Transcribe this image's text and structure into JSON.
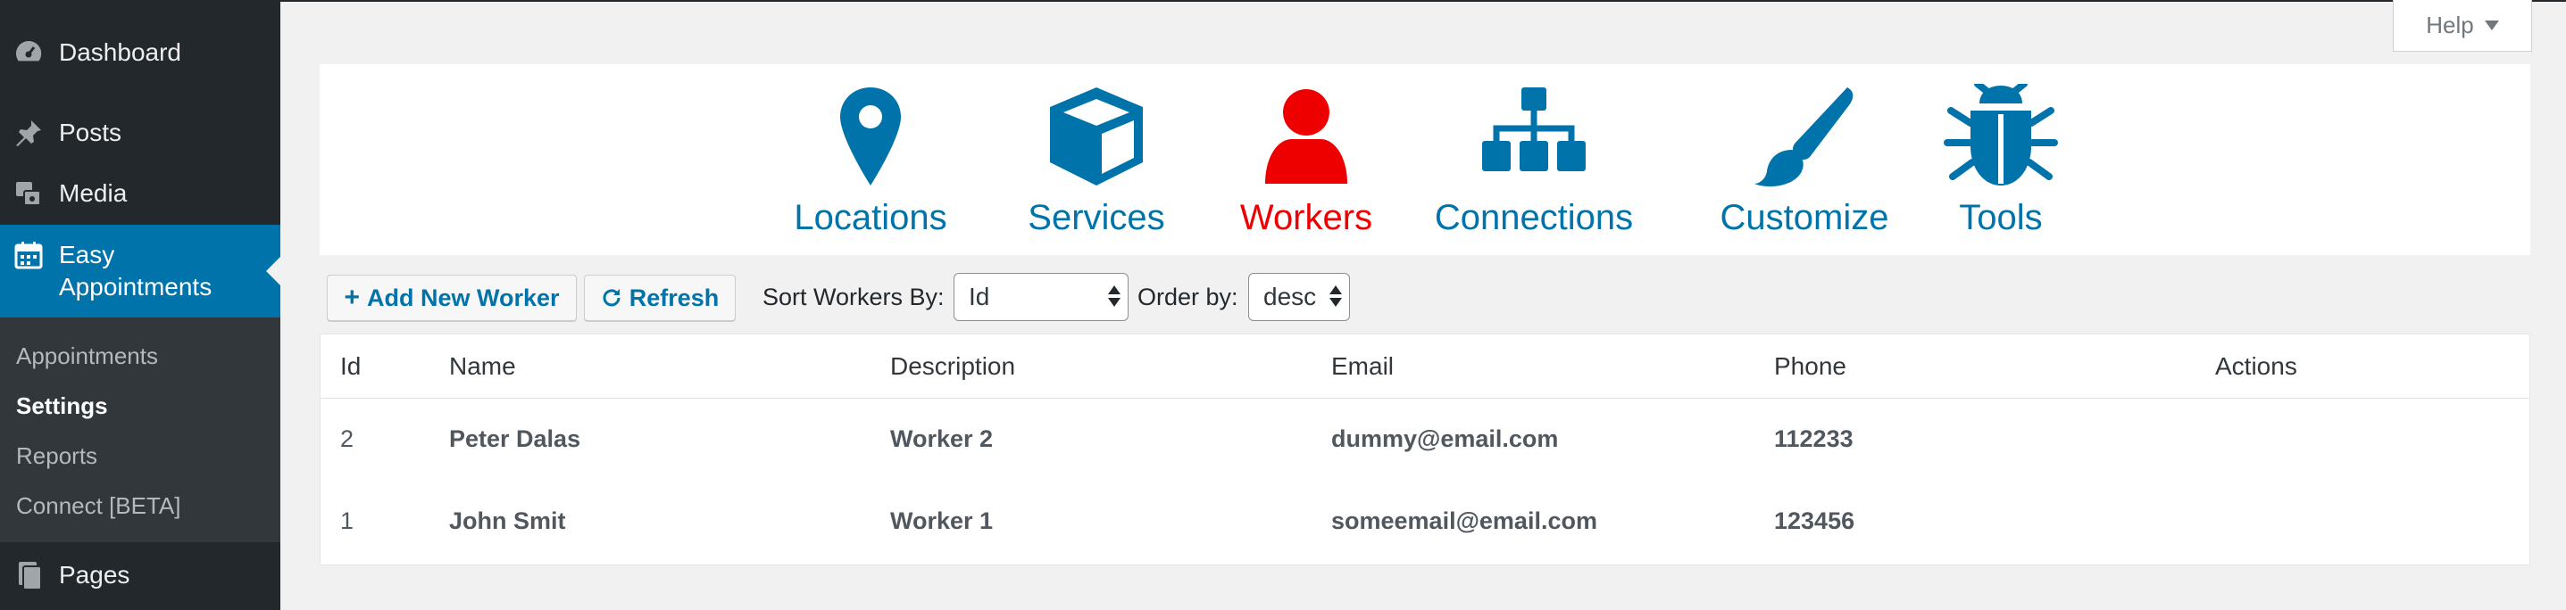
{
  "sidebar": {
    "items": [
      {
        "label": "Dashboard",
        "icon": "dashboard-icon"
      },
      {
        "label": "Posts",
        "icon": "pushpin-icon"
      },
      {
        "label": "Media",
        "icon": "media-icon"
      },
      {
        "label": "Easy Appointments",
        "label_line1": "Easy",
        "label_line2": "Appointments",
        "icon": "calendar-icon",
        "active": true
      },
      {
        "label": "Pages",
        "icon": "pages-icon"
      }
    ],
    "submenu": [
      "Appointments",
      "Settings",
      "Reports",
      "Connect [BETA]"
    ],
    "current_submenu": "Settings"
  },
  "help": {
    "label": "Help"
  },
  "nav": {
    "tiles": [
      {
        "label": "Locations",
        "icon": "map-pin-icon"
      },
      {
        "label": "Services",
        "icon": "cube-icon"
      },
      {
        "label": "Workers",
        "icon": "user-icon",
        "selected": true
      },
      {
        "label": "Connections",
        "icon": "sitemap-icon"
      },
      {
        "label": "Customize",
        "icon": "paint-brush-icon"
      },
      {
        "label": "Tools",
        "icon": "bug-icon"
      }
    ],
    "accent_color": "#0073aa",
    "selected_color": "#ee0000"
  },
  "toolbar": {
    "add_label": "Add New Worker",
    "refresh_label": "Refresh",
    "sort_label": "Sort Workers By:",
    "sort_value": "Id",
    "order_label": "Order by:",
    "order_value": "desc"
  },
  "table": {
    "columns": [
      "Id",
      "Name",
      "Description",
      "Email",
      "Phone",
      "Actions"
    ],
    "rows": [
      {
        "id": "2",
        "name": "Peter Dalas",
        "description": "Worker 2",
        "email": "dummy@email.com",
        "phone": "112233"
      },
      {
        "id": "1",
        "name": "John Smit",
        "description": "Worker 1",
        "email": "someemail@email.com",
        "phone": "123456"
      }
    ]
  }
}
